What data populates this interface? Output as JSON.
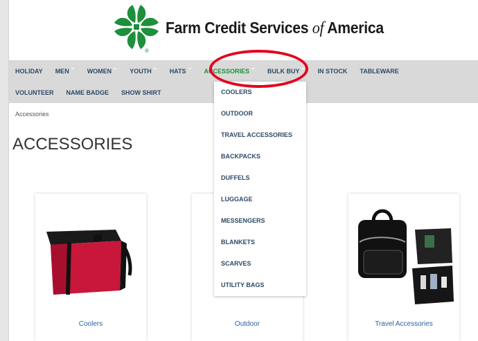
{
  "brand": {
    "name_part1": "Farm Credit Services ",
    "name_of": "of",
    "name_part2": " America",
    "registered": "®",
    "logo_green": "#1e8f3c"
  },
  "nav": {
    "row1": [
      {
        "label": "HOLIDAY",
        "caret": false
      },
      {
        "label": "MEN",
        "caret": true
      },
      {
        "label": "WOMEN",
        "caret": true
      },
      {
        "label": "YOUTH",
        "caret": true
      },
      {
        "label": "HATS",
        "caret": true
      },
      {
        "label": "ACCESSORIES",
        "caret": true,
        "active": true
      },
      {
        "label": "BULK BUY",
        "caret": true
      },
      {
        "label": "IN STOCK",
        "caret": false
      },
      {
        "label": "TABLEWARE",
        "caret": false
      }
    ],
    "row2": [
      {
        "label": "VOLUNTEER"
      },
      {
        "label": "NAME BADGE"
      },
      {
        "label": "SHOW SHIRT"
      }
    ],
    "active_color": "#1e8f3c",
    "text_color": "#2c4a66"
  },
  "dropdown": {
    "items": [
      "COOLERS",
      "OUTDOOR",
      "TRAVEL ACCESSORIES",
      "BACKPACKS",
      "DUFFELS",
      "LUGGAGE",
      "MESSENGERS",
      "BLANKETS",
      "SCARVES",
      "UTILITY BAGS"
    ]
  },
  "breadcrumb": "Accessories",
  "page_title": "ACCESSORIES",
  "cards": [
    {
      "label": "Coolers"
    },
    {
      "label": "Outdoor"
    },
    {
      "label": "Travel Accessories"
    }
  ],
  "annotation_color": "#e3001b"
}
